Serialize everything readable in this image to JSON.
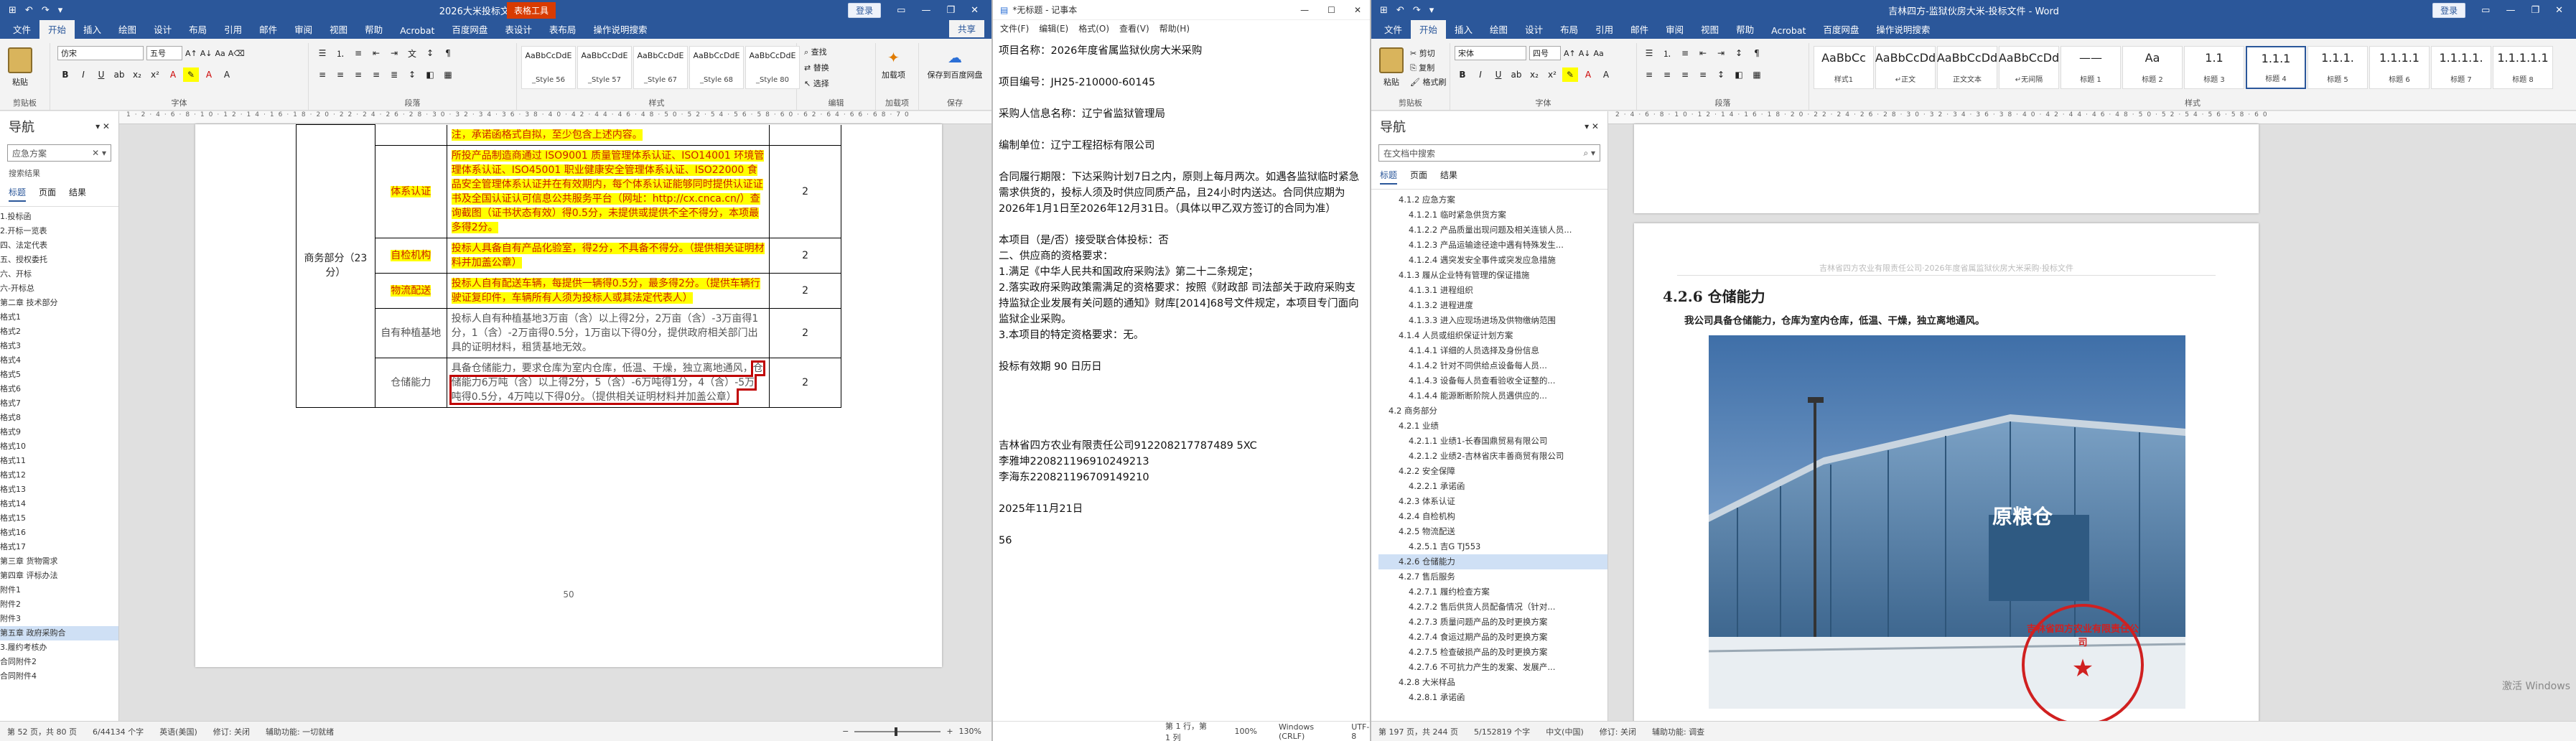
{
  "win1": {
    "title": "2026大米投标文件  -  Word",
    "context_tab": "表格工具",
    "login_label": "登录",
    "share_label": "共享",
    "tabs": [
      "文件",
      "开始",
      "插入",
      "绘图",
      "设计",
      "布局",
      "引用",
      "邮件",
      "审阅",
      "视图",
      "帮助",
      "Acrobat",
      "百度网盘",
      "表设计",
      "表布局",
      "操作说明搜索"
    ],
    "ribbon": {
      "paste": "粘贴",
      "font": "仿宋",
      "size": "五号",
      "styles": [
        {
          "sample": "AaBbCcDdE",
          "name": "_Style 56"
        },
        {
          "sample": "AaBbCcDdE",
          "name": "_Style 57"
        },
        {
          "sample": "AaBbCcDdE",
          "name": "_Style 67"
        },
        {
          "sample": "AaBbCcDdE",
          "name": "_Style 68"
        },
        {
          "sample": "AaBbCcDdE",
          "name": "_Style 80"
        }
      ],
      "edit_find": "查找",
      "edit_replace": "替换",
      "edit_select": "选择",
      "addin": "加载项",
      "baidu": "保存到百度网盘",
      "groups": [
        "剪贴板",
        "字体",
        "段落",
        "样式",
        "编辑",
        "加载项",
        "保存"
      ]
    },
    "nav": {
      "title": "导航",
      "search": "应急方案",
      "result_count": "搜索结果",
      "tabs": [
        "标题",
        "页面",
        "结果"
      ],
      "items": [
        "1.投标函",
        "2.开标一览表",
        "四、法定代表",
        "五、授权委托",
        "六、开标",
        "六-开标总",
        "第二章 技术部分",
        "格式1",
        "格式2",
        "格式3",
        "格式4",
        "格式5",
        "格式6",
        "格式7",
        "格式8",
        "格式9",
        "格式10",
        "格式11",
        "格式12",
        "格式13",
        "格式14",
        "格式15",
        "格式16",
        "格式17",
        "第三章 货物需求",
        "第四章 评标办法",
        "附件1",
        "附件2",
        "附件3",
        "第五章 政府采购合",
        "3.履约考核办",
        "合同附件2",
        "合同附件4"
      ],
      "selected_index": 29
    },
    "table": {
      "top_text": "注，承诺函格式自拟，至少包含上述内容。",
      "section_label": "商务部分（23分）",
      "rows": [
        {
          "label": "体系认证",
          "content": "所投产品制造商通过 ISO9001 质量管理体系认证、ISO14001 环境管理体系认证、ISO45001 职业健康安全管理体系认证、ISO22000 食品安全管理体系认证并在有效期内，每个体系认证能够同时提供认证证书及全国认证认可信息公共服务平台（网址：http://cx.cnca.cn/）查询截图（证书状态有效）得0.5分，未提供或提供不全不得分，本项最多得2分。",
          "score": "2"
        },
        {
          "label": "自检机构",
          "content": "投标人具备自有产品化验室，得2分，不具备不得分。（提供相关证明材料并加盖公章）",
          "score": "2"
        },
        {
          "label": "物流配送",
          "content": "投标人自有配送车辆，每提供一辆得0.5分，最多得2分。（提供车辆行驶证复印件，车辆所有人须为投标人或其法定代表人）",
          "score": "2"
        },
        {
          "label": "自有种植基地",
          "content": "投标人自有种植基地3万亩（含）以上得2分，2万亩（含）-3万亩得1分，1（含）-2万亩得0.5分，1万亩以下得0分，提供政府相关部门出具的证明材料，租赁基地无效。",
          "score": "2"
        },
        {
          "label": "仓储能力",
          "content_pre": "具备仓储能力，要求仓库为室内仓库，低温、干燥，独立离地通风，",
          "content_boxed": "仓储能力6万吨（含）以上得2分，5（含）-6万吨得1分，4（含）-5万吨得0.5分，4万吨以下得0分。（提供相关证明材料并加盖公章）",
          "score": "2"
        }
      ],
      "page_number": "50"
    },
    "status": {
      "page": "第 52 页，共 80 页",
      "words": "6/44134 个字",
      "lang": "英语(美国)",
      "track": "修订: 关闭",
      "access": "辅助功能: 一切就绪",
      "zoom": "130%"
    }
  },
  "win2": {
    "title": "*无标题 - 记事本",
    "menu": [
      "文件(F)",
      "编辑(E)",
      "格式(O)",
      "查看(V)",
      "帮助(H)"
    ],
    "lines": [
      "项目名称：2026年度省属监狱伙房大米采购",
      "项目编号：JH25-210000-60145",
      "采购人信息名称：辽宁省监狱管理局",
      "编制单位：辽宁工程招标有限公司",
      "合同履行期限：下达采购计划7日之内，原则上每月两次。如遇各监狱临时紧急需求供货的，投标人须及时供应同质产品，且24小时内送达。合同供应期为2026年1月1日至2026年12月31日。（具体以甲乙双方签订的合同为准）",
      "本项目（是/否）接受联合体投标：否",
      "二、供应商的资格要求：",
      "1.满足《中华人民共和国政府采购法》第二十二条规定；",
      "2.落实政府采购政策需满足的资格要求：按照《财政部 司法部关于政府采购支持监狱企业发展有关问题的通知》财库[2014]68号文件规定，本项目专门面向监狱企业采购。",
      "3.本项目的特定资格要求：无。",
      "投标有效期 90  日历日",
      "吉林省四方农业有限责任公司912208217787489 5XC",
      "李雅坤220821196910249213",
      "李海东220821196709149210",
      "2025年11月21日",
      "56"
    ],
    "status": {
      "pos": "第 1 行，第 1 列",
      "zoom": "100%",
      "eol": "Windows (CRLF)",
      "enc": "UTF-8"
    }
  },
  "win3": {
    "title": "吉林四方-监狱伙房大米-投标文件  -  Word",
    "login_label": "登录",
    "tabs": [
      "文件",
      "开始",
      "插入",
      "绘图",
      "设计",
      "布局",
      "引用",
      "邮件",
      "审阅",
      "视图",
      "帮助",
      "Acrobat",
      "百度网盘",
      "操作说明搜索"
    ],
    "ribbon": {
      "paste": "粘贴",
      "cut": "剪切",
      "copy": "复制",
      "painter": "格式刷",
      "font": "宋体",
      "size": "四号",
      "styles": [
        {
          "sample": "AaBbCc",
          "name": "样式1"
        },
        {
          "sample": "AaBbCcDd",
          "name": "↵正文"
        },
        {
          "sample": "AaBbCcDd",
          "name": "正文文本"
        },
        {
          "sample": "AaBbCcDd",
          "name": "↵无间隔"
        },
        {
          "sample": "——",
          "name": "标题 1"
        },
        {
          "sample": "Aa",
          "name": "标题 2"
        },
        {
          "sample": "1.1",
          "name": "标题 3"
        },
        {
          "sample": "1.1.1",
          "name": "标题 4"
        },
        {
          "sample": "1.1.1.",
          "name": "标题 5"
        },
        {
          "sample": "1.1.1.1",
          "name": "标题 6"
        },
        {
          "sample": "1.1.1.1.",
          "name": "标题 7"
        },
        {
          "sample": "1.1.1.1.1",
          "name": "标题 8"
        }
      ],
      "groups": [
        "剪贴板",
        "字体",
        "段落",
        "样式"
      ]
    },
    "nav": {
      "title": "导航",
      "search_placeholder": "在文档中搜索",
      "tabs": [
        "标题",
        "页面",
        "结果"
      ],
      "items": [
        "4.1.2 应急方案",
        "4.1.2.1 临时紧急供货方案",
        "4.1.2.2 产品质量出现问题及相关连锁人员...",
        "4.1.2.3 产品运输途径途中遇有特殊发生...",
        "4.1.2.4 遇突发安全事件或突发应急措施",
        "4.1.3 履从企业特有管理的保证措施",
        "4.1.3.1 进程组织",
        "4.1.3.2 进程进度",
        "4.1.3.3 进入应现场进场及供物缴纳范围",
        "4.1.4 人员或组织保证计划方案",
        "4.1.4.1 详细的人员选择及身份信息",
        "4.1.4.2 针对不同供给点设备每人员...",
        "4.1.4.3 设备每人员查看验收全证整的...",
        "4.1.4.4 能源断断阶院人员遇供应的...",
        "4.2 商务部分",
        "4.2.1 业绩",
        "4.2.1.1 业绩1-长春国鼎贸易有限公司",
        "4.2.1.2 业绩2-吉林省庆丰善商贸有限公司",
        "4.2.2 安全保障",
        "4.2.2.1 承诺函",
        "4.2.3 体系认证",
        "4.2.4 自检机构",
        "4.2.5 物流配送",
        "4.2.5.1 吉G TJ553",
        "4.2.6 仓储能力",
        "4.2.7 售后服务",
        "4.2.7.1 履约检查方案",
        "4.2.7.2 售后供货人员配备情况（针对...",
        "4.2.7.3 质量问题产品的及时更换方案",
        "4.2.7.4 食运过期产品的及时更换方案",
        "4.2.7.5 检查破损产品的及时更换方案",
        "4.2.7.6 不可抗力产生的发案、发展产...",
        "4.2.8 大米样品",
        "4.2.8.1 承诺函"
      ],
      "selected_index": 24
    },
    "doc": {
      "header_text": "吉林省四方农业有限责任公司·2026年度省属监狱伙房大米采购·投标文件",
      "heading": "4.2.6 仓储能力",
      "body": "我公司具备仓储能力，仓库为室内仓库，低温、干燥，独立离地通风。",
      "photo_sign": "原粮仓",
      "seal_text": "吉林省四方农业有限责任公司"
    },
    "status": {
      "page": "第 197 页，共 244 页",
      "words": "5/152819 个字",
      "lang": "中文(中国)",
      "track": "修订: 关闭",
      "access": "辅助功能: 调查"
    },
    "watermark": "激活 Windows"
  }
}
